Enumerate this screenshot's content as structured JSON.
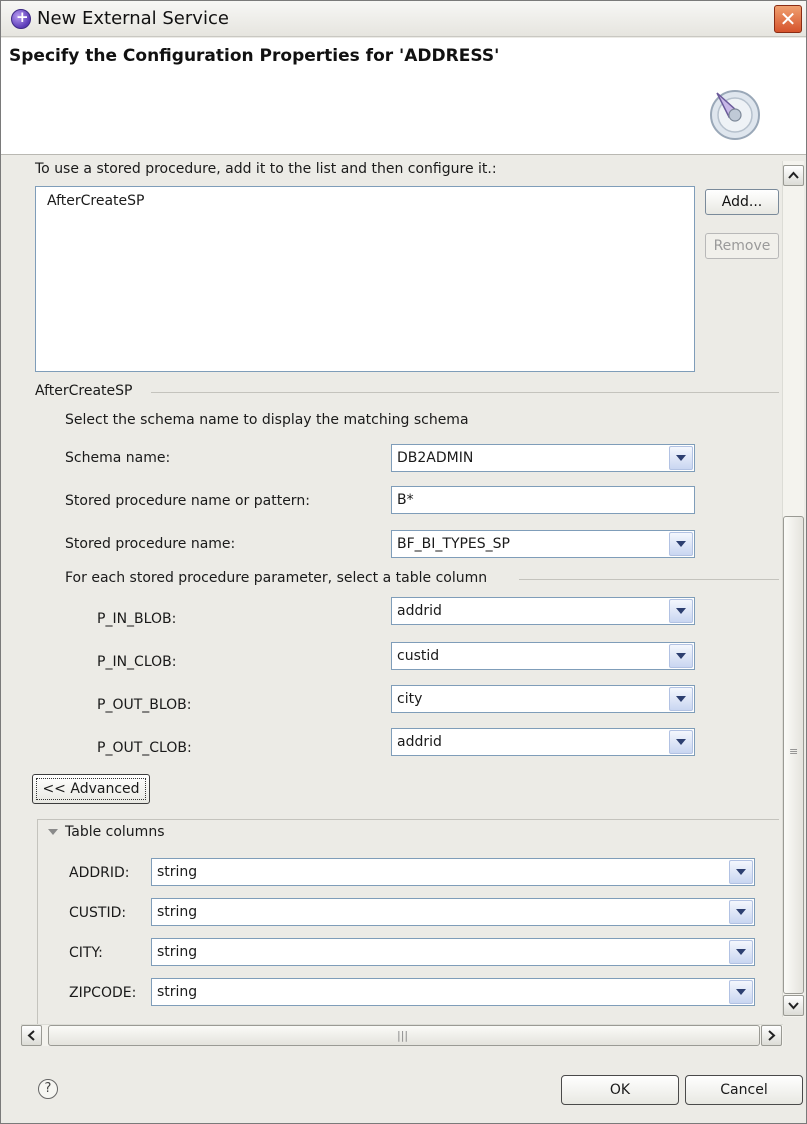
{
  "window": {
    "title": "New External Service",
    "heading": "Specify the Configuration Properties for 'ADDRESS'"
  },
  "procedures": {
    "instruction": "To use a stored procedure, add it to the list and then configure it.:",
    "items": [
      "AfterCreateSP"
    ],
    "add_label": "Add...",
    "remove_label": "Remove"
  },
  "selected": {
    "group_title": "AfterCreateSP",
    "schema_hint": "Select the schema name to display the matching schema",
    "schema_label": "Schema name:",
    "schema_value": "DB2ADMIN",
    "pattern_label": "Stored procedure name or pattern:",
    "pattern_value": "B*",
    "sp_name_label": "Stored procedure name:",
    "sp_name_value": "BF_BI_TYPES_SP",
    "params_title": "For each stored procedure parameter, select a table column",
    "params": [
      {
        "name": "P_IN_BLOB:",
        "value": "addrid"
      },
      {
        "name": "P_IN_CLOB:",
        "value": "custid"
      },
      {
        "name": "P_OUT_BLOB:",
        "value": "city"
      },
      {
        "name": "P_OUT_CLOB:",
        "value": "addrid"
      }
    ]
  },
  "advanced": {
    "button_label": "<< Advanced",
    "section_title": "Table columns",
    "columns": [
      {
        "name": "ADDRID:",
        "type": "string"
      },
      {
        "name": "CUSTID:",
        "type": "string"
      },
      {
        "name": "CITY:",
        "type": "string"
      },
      {
        "name": "ZIPCODE:",
        "type": "string"
      }
    ]
  },
  "footer": {
    "help_glyph": "?",
    "ok_label": "OK",
    "cancel_label": "Cancel"
  },
  "colors": {
    "accent": "#7f9db9",
    "close": "#d6532c"
  }
}
